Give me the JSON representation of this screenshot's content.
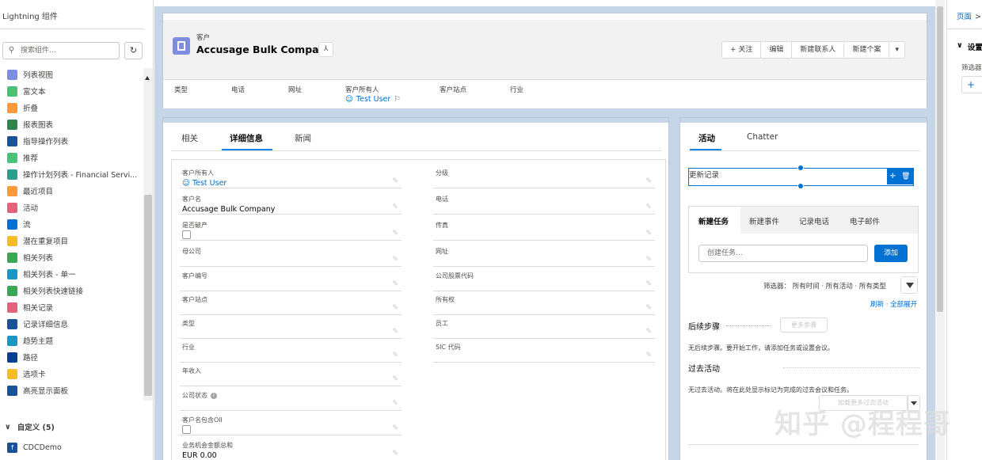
{
  "left_panel": {
    "title": "Lightning 组件",
    "search_placeholder": "搜索组件...",
    "refresh_icon": "refresh-icon",
    "components": [
      {
        "label": "列表视图",
        "color": "#7f8de1"
      },
      {
        "label": "富文本",
        "color": "#4bc076"
      },
      {
        "label": "折叠",
        "color": "#ff9a3c"
      },
      {
        "label": "报表图表",
        "color": "#2e844a"
      },
      {
        "label": "指导操作列表",
        "color": "#1b5297"
      },
      {
        "label": "推荐",
        "color": "#4bc076"
      },
      {
        "label": "操作计划列表 - Financial Servi...",
        "color": "#2a9d8f"
      },
      {
        "label": "最近项目",
        "color": "#ff9a3c"
      },
      {
        "label": "活动",
        "color": "#e3647a"
      },
      {
        "label": "流",
        "color": "#0070d2"
      },
      {
        "label": "潜在重复项目",
        "color": "#f4bc25"
      },
      {
        "label": "相关列表",
        "color": "#3ba755"
      },
      {
        "label": "相关列表 - 单一",
        "color": "#1b96c4"
      },
      {
        "label": "相关列表快速链接",
        "color": "#3ba755"
      },
      {
        "label": "相关记录",
        "color": "#e3647a"
      },
      {
        "label": "记录详细信息",
        "color": "#1b5297"
      },
      {
        "label": "趋势主题",
        "color": "#1b96c4"
      },
      {
        "label": "路径",
        "color": "#0b3d91"
      },
      {
        "label": "选项卡",
        "color": "#f4bc25"
      },
      {
        "label": "高亮显示面板",
        "color": "#1b5297"
      }
    ],
    "custom_section": {
      "label": "自定义 (5)",
      "items": [
        {
          "label": "CDCDemo",
          "color": "#1b5297"
        }
      ]
    }
  },
  "header": {
    "object_type": "客户",
    "record_name": "Accusage Bulk Company",
    "hierarchy_icon": "hierarchy-icon",
    "actions": [
      "+ 关注",
      "编辑",
      "新建联系人",
      "新建个案"
    ],
    "fields": [
      "类型",
      "电话",
      "网址",
      "客户所有人",
      "客户站点",
      "行业"
    ],
    "owner_value": "Test User"
  },
  "main_tabs": [
    "相关",
    "详细信息",
    "新闻"
  ],
  "active_tab": "详细信息",
  "detail_left": [
    {
      "label": "客户所有人",
      "value": "Test User",
      "kind": "link"
    },
    {
      "label": "客户名",
      "value": "Accusage Bulk Company",
      "kind": "text"
    },
    {
      "label": "是否破产",
      "value": "",
      "kind": "checkbox"
    },
    {
      "label": "母公司",
      "value": "",
      "kind": "text"
    },
    {
      "label": "客户编号",
      "value": "",
      "kind": "text"
    },
    {
      "label": "客户站点",
      "value": "",
      "kind": "text"
    },
    {
      "label": "类型",
      "value": "",
      "kind": "text"
    },
    {
      "label": "行业",
      "value": "",
      "kind": "text"
    },
    {
      "label": "年收入",
      "value": "",
      "kind": "text"
    },
    {
      "label": "公司状态",
      "value": "",
      "kind": "info"
    },
    {
      "label": "客户名包含Oll",
      "value": "",
      "kind": "checkbox"
    },
    {
      "label": "业务机会金额总和",
      "value": "EUR 0.00",
      "kind": "text"
    }
  ],
  "detail_right": [
    {
      "label": "分级"
    },
    {
      "label": "电话"
    },
    {
      "label": "传真"
    },
    {
      "label": "网址"
    },
    {
      "label": "公司股票代码"
    },
    {
      "label": "所有权"
    },
    {
      "label": "员工"
    },
    {
      "label": "SIC 代码"
    }
  ],
  "activity": {
    "tabs": [
      "活动",
      "Chatter"
    ],
    "update_label": "更新记录",
    "composer_tabs": [
      "新建任务",
      "新建事件",
      "记录电话",
      "电子邮件"
    ],
    "task_placeholder": "创建任务...",
    "add_label": "添加",
    "filter_text": "筛选器： 所有时间 · 所有活动 · 所有类型",
    "refresh_link": "刷新",
    "expand_link": "全部展开",
    "next_steps_title": "后续步骤",
    "more_steps": "更多步骤",
    "next_steps_msg": "无后续步骤。要开始工作，请添加任务或设置会议。",
    "past_title": "过去活动",
    "past_msg": "无过去活动。将在此处显示标记为完成的过去会议和任务。",
    "load_more": "加载更多过去活动"
  },
  "right_panel": {
    "breadcrumb": "页面",
    "breadcrumb_sep": ">",
    "section": "设置",
    "filter_label": "筛选器",
    "add_symbol": "+"
  },
  "watermark": "知乎 @程程哥"
}
